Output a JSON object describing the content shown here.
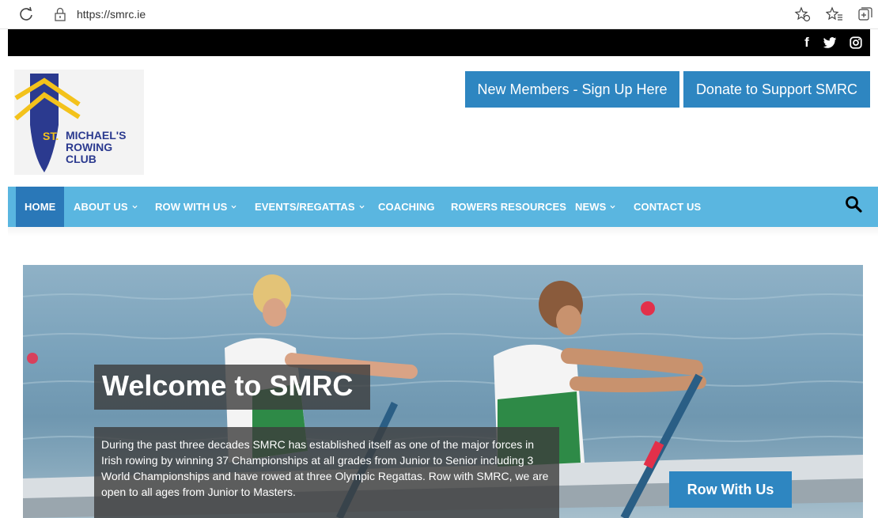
{
  "browser": {
    "url": "https://smrc.ie",
    "icons": [
      "reload-icon",
      "lock-icon",
      "favorites-add-icon",
      "favorites-icon",
      "collections-icon"
    ]
  },
  "social": {
    "icons": [
      "facebook-icon",
      "twitter-icon",
      "instagram-icon"
    ],
    "facebook_glyph": "f"
  },
  "header": {
    "logo": {
      "st": "ST.",
      "line1": "MICHAEL'S",
      "line2": "ROWING CLUB",
      "colors": {
        "navy": "#2b3a8f",
        "gold": "#f3c21b"
      }
    },
    "buttons": {
      "signup": "New Members - Sign Up Here",
      "donate": "Donate to Support SMRC"
    }
  },
  "nav": {
    "items": [
      {
        "label": "HOME",
        "dropdown": false,
        "active": true
      },
      {
        "label": "ABOUT US",
        "dropdown": true
      },
      {
        "label": "ROW WITH US",
        "dropdown": true
      },
      {
        "label": "EVENTS/REGATTAS",
        "dropdown": true
      },
      {
        "label": "COACHING",
        "dropdown": false
      },
      {
        "label": "ROWERS RESOURCES",
        "dropdown": false
      },
      {
        "label": "NEWS",
        "dropdown": true
      },
      {
        "label": "CONTACT US",
        "dropdown": false
      }
    ],
    "search_icon": "search-icon"
  },
  "hero": {
    "title": "Welcome to SMRC",
    "description": "During the past three decades SMRC has established itself as one of the major forces in Irish rowing by winning 37 Championships at all grades from Junior to Senior including 3 World Championships and have rowed at three Olympic Regattas. Row with SMRC, we are open to all ages from Junior to Masters.",
    "cta": "Row With Us"
  },
  "colors": {
    "nav_bg": "#5ab6e0",
    "nav_active": "#2a78b8",
    "button": "#2e86c1",
    "social_bar": "#000000"
  }
}
